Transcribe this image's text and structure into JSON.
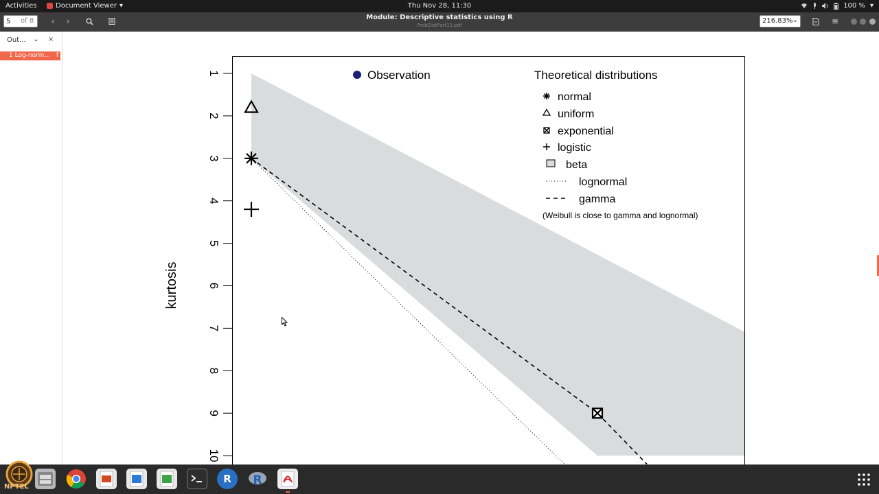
{
  "topbar": {
    "activities": "Activities",
    "app_name": "Document Viewer",
    "app_menu_arrow": "▾",
    "clock": "Thu Nov 28, 11:30",
    "battery": "100 %"
  },
  "toolbar": {
    "page_value": "5",
    "page_of": "of 8",
    "title": "Module: Descriptive statistics using R",
    "subtitle": "ProbDistPart11.pdf",
    "zoom": "216.83%",
    "prev_icon": "‹",
    "next_icon": "›",
    "search_icon": "⌕",
    "sidebar_icon": "▯",
    "menu_icon": "≡"
  },
  "sidebar": {
    "mode": "Out...",
    "close": "×",
    "outline": [
      {
        "title": "1 Log-norm...",
        "page": "f"
      }
    ]
  },
  "chart_data": {
    "type": "scatter",
    "ylabel": "kurtosis",
    "ylim": [
      10,
      1
    ],
    "y_ticks": [
      "1",
      "2",
      "3",
      "4",
      "5",
      "6",
      "7",
      "8",
      "9",
      "10"
    ],
    "xlim": [
      0,
      1.5
    ],
    "legend": {
      "observation": "Observation",
      "theoretical_title": "Theoretical distributions",
      "entries": [
        "normal",
        "uniform",
        "exponential",
        "logistic",
        "beta",
        "lognormal",
        "gamma"
      ],
      "note": "(Weibull is close to gamma and lognormal)"
    },
    "points": [
      {
        "name": "normal",
        "x": 0,
        "y": 3,
        "marker": "asterisk"
      },
      {
        "name": "uniform",
        "x": 0,
        "y": 1.8,
        "marker": "triangle"
      },
      {
        "name": "logistic",
        "x": 0,
        "y": 4.2,
        "marker": "plus"
      },
      {
        "name": "exponential",
        "x": 1.05,
        "y": 9,
        "marker": "boxed-x"
      }
    ],
    "beta_region": [
      [
        0,
        1
      ],
      [
        1.5,
        7.1
      ],
      [
        1.5,
        10
      ],
      [
        1.05,
        10
      ],
      [
        0,
        3
      ]
    ],
    "gamma_line": [
      [
        0,
        3
      ],
      [
        1.05,
        9
      ],
      [
        1.2,
        10.2
      ]
    ],
    "lognormal_line": [
      [
        0,
        3
      ],
      [
        0.95,
        10.2
      ]
    ],
    "colors": {
      "beta_fill": "#d9dcdc",
      "observation": "#1a1f7a"
    }
  },
  "taskbar": {
    "nptel": "NPTEL",
    "items": [
      "nptel-logo",
      "files",
      "chrome",
      "impress",
      "writer",
      "calc",
      "terminal",
      "r",
      "rstudio",
      "document-viewer"
    ],
    "r_label": "R"
  }
}
